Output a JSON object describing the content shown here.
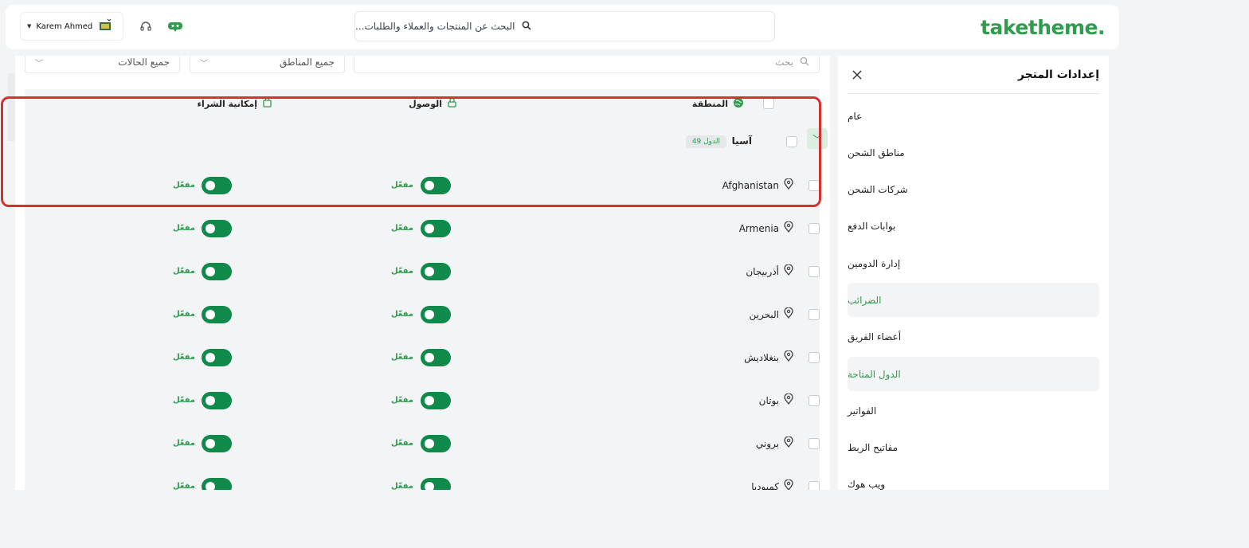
{
  "header": {
    "logo_main": "taketheme",
    "logo_dot": ".",
    "search_placeholder": "البحث عن المنتجات والعملاء والطلبات...",
    "user_name": "Karem Ahmed"
  },
  "filters": {
    "search_label": "بحث",
    "zones_select": "جميع المناطق",
    "status_select": "جميع الحالات"
  },
  "table": {
    "headers": {
      "region": "المنطقة",
      "access": "الوصول",
      "purchase": "إمكانية الشراء"
    },
    "group": {
      "name": "آسيا",
      "badge": "49 الدول"
    },
    "countries": [
      {
        "name": "Afghanistan",
        "access_label": "مفعّل",
        "purchase_label": "مفعّل"
      },
      {
        "name": "Armenia",
        "access_label": "مفعّل",
        "purchase_label": "مفعّل"
      },
      {
        "name": "أذربيجان",
        "access_label": "مفعّل",
        "purchase_label": "مفعّل"
      },
      {
        "name": "البحرين",
        "access_label": "مفعّل",
        "purchase_label": "مفعّل"
      },
      {
        "name": "بنغلاديش",
        "access_label": "مفعّل",
        "purchase_label": "مفعّل"
      },
      {
        "name": "بوتان",
        "access_label": "مفعّل",
        "purchase_label": "مفعّل"
      },
      {
        "name": "بروني",
        "access_label": "مفعّل",
        "purchase_label": "مفعّل"
      },
      {
        "name": "كمبوديا",
        "access_label": "مفعّل",
        "purchase_label": "مفعّل"
      }
    ]
  },
  "settings": {
    "title": "إعدادات المتجر",
    "items": [
      {
        "label": "عام"
      },
      {
        "label": "مناطق الشحن"
      },
      {
        "label": "شركات الشحن"
      },
      {
        "label": "بوابات الدفع"
      },
      {
        "label": "إدارة الدومين"
      },
      {
        "label": "الضرائب"
      },
      {
        "label": "أعضاء الفريق"
      },
      {
        "label": "الدول المتاحة"
      },
      {
        "label": "الفواتير"
      },
      {
        "label": "مفاتيح الربط"
      },
      {
        "label": "ويب هوك"
      }
    ]
  },
  "colors": {
    "brand": "#2f9c4e",
    "toggle_on": "#0f8a4a",
    "highlight": "#d63031"
  }
}
